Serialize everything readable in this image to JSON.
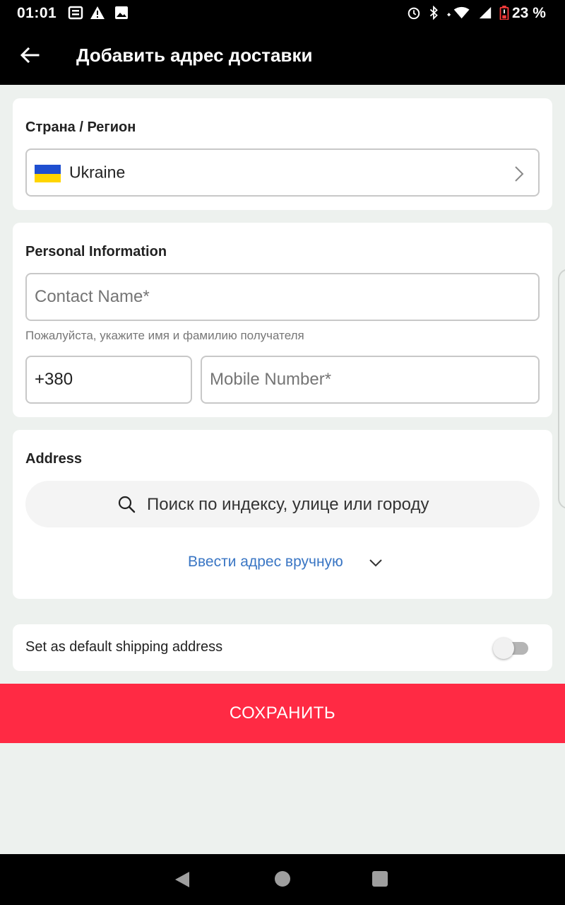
{
  "status_bar": {
    "time": "01:01",
    "battery_text": "23 %",
    "icons": [
      "news-icon",
      "warning-icon",
      "image-icon",
      "alarm-icon",
      "bluetooth-icon",
      "wifi-icon",
      "signal-icon",
      "battery-icon"
    ]
  },
  "header": {
    "title": "Добавить адрес доставки",
    "back_icon": "arrow-left-icon"
  },
  "country_section": {
    "title": "Страна / Регион",
    "country_value": "Ukraine",
    "flag_colors": [
      "#1f4fd0",
      "#ffd500"
    ]
  },
  "personal_section": {
    "title": "Personal Information",
    "contact_name_placeholder": "Contact Name*",
    "contact_hint": "Пожалуйста, укажите имя и фамилию получателя",
    "phone_code": "+380",
    "mobile_placeholder": "Mobile Number*"
  },
  "address_section": {
    "title": "Address",
    "search_placeholder": "Поиск по индексу, улице или городу",
    "manual_link": "Ввести адрес вручную"
  },
  "default_section": {
    "label": "Set as default shipping address",
    "toggle_on": false
  },
  "save_button": {
    "label": "СОХРАНИТЬ",
    "color": "#ff2a44"
  },
  "colors": {
    "link": "#3a76c4",
    "background": "#edf1ee"
  }
}
